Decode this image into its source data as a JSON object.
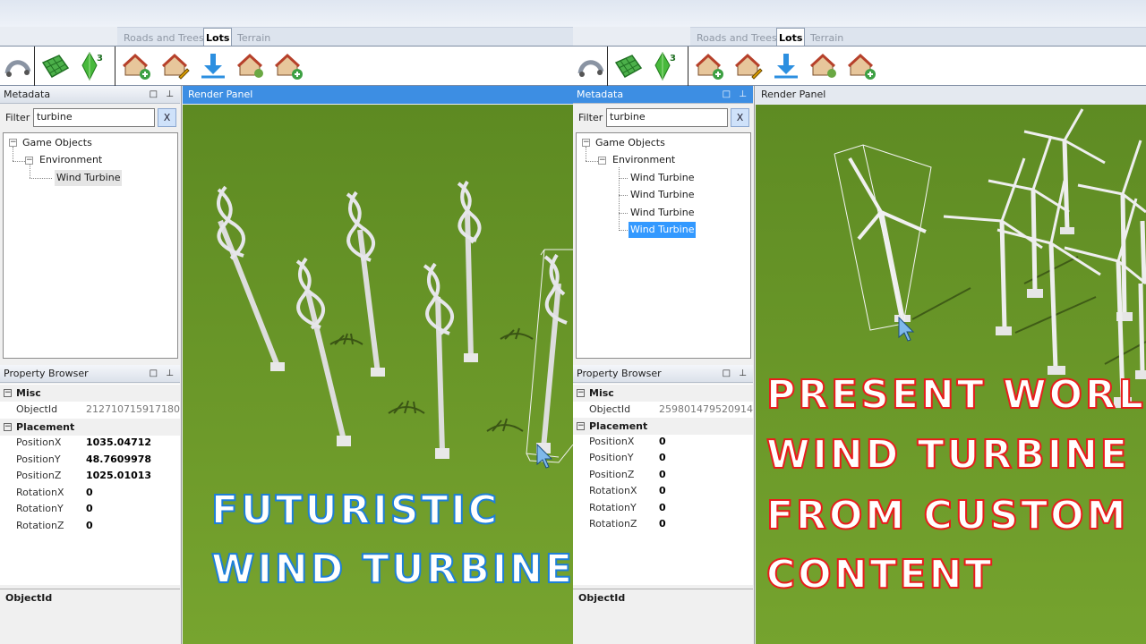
{
  "left": {
    "tabs": [
      "Roads and Trees",
      "Lots",
      "Terrain"
    ],
    "metadata": {
      "title": "Metadata",
      "filter_label": "Filter",
      "filter_value": "turbine",
      "clear_label": "X"
    },
    "tree": {
      "root": "Game Objects",
      "env": "Environment",
      "items": [
        "Wind Turbine"
      ]
    },
    "render_title": "Render Panel",
    "property_browser": {
      "title": "Property Browser",
      "cat_misc": "Misc",
      "objectid_label": "ObjectId",
      "objectid_value": "212710715917180",
      "cat_placement": "Placement",
      "rows": [
        {
          "k": "PositionX",
          "v": "1035.04712"
        },
        {
          "k": "PositionY",
          "v": "48.7609978"
        },
        {
          "k": "PositionZ",
          "v": "1025.01013"
        },
        {
          "k": "RotationX",
          "v": "0"
        },
        {
          "k": "RotationY",
          "v": "0"
        },
        {
          "k": "RotationZ",
          "v": "0"
        }
      ],
      "desc_title": "ObjectId"
    },
    "overlay": {
      "line1": "FUTURISTIC",
      "line2": "WIND TURBINE",
      "color": "#1e7fd8"
    }
  },
  "right": {
    "tabs": [
      "Roads and Trees",
      "Lots",
      "Terrain"
    ],
    "metadata": {
      "title": "Metadata",
      "filter_label": "Filter",
      "filter_value": "turbine",
      "clear_label": "X"
    },
    "tree": {
      "root": "Game Objects",
      "env": "Environment",
      "items": [
        "Wind Turbine",
        "Wind Turbine",
        "Wind Turbine",
        "Wind Turbine"
      ]
    },
    "render_title": "Render Panel",
    "property_browser": {
      "title": "Property Browser",
      "cat_misc": "Misc",
      "objectid_label": "ObjectId",
      "objectid_value": "259801479520914",
      "cat_placement": "Placement",
      "rows": [
        {
          "k": "PositionX",
          "v": "0"
        },
        {
          "k": "PositionY",
          "v": "0"
        },
        {
          "k": "PositionZ",
          "v": "0"
        },
        {
          "k": "RotationX",
          "v": "0"
        },
        {
          "k": "RotationY",
          "v": "0"
        },
        {
          "k": "RotationZ",
          "v": "0"
        }
      ],
      "desc_title": "ObjectId"
    },
    "overlay": {
      "line1": "PRESENT WORLD",
      "line2": "WIND TURBINE",
      "line3": "FROM CUSTOM",
      "line4": "CONTENT",
      "color": "#e81c1c"
    }
  },
  "colors": {
    "grass": "#6c9a2c",
    "selection": "#3399ff",
    "header_active": "#3d8ee3"
  }
}
